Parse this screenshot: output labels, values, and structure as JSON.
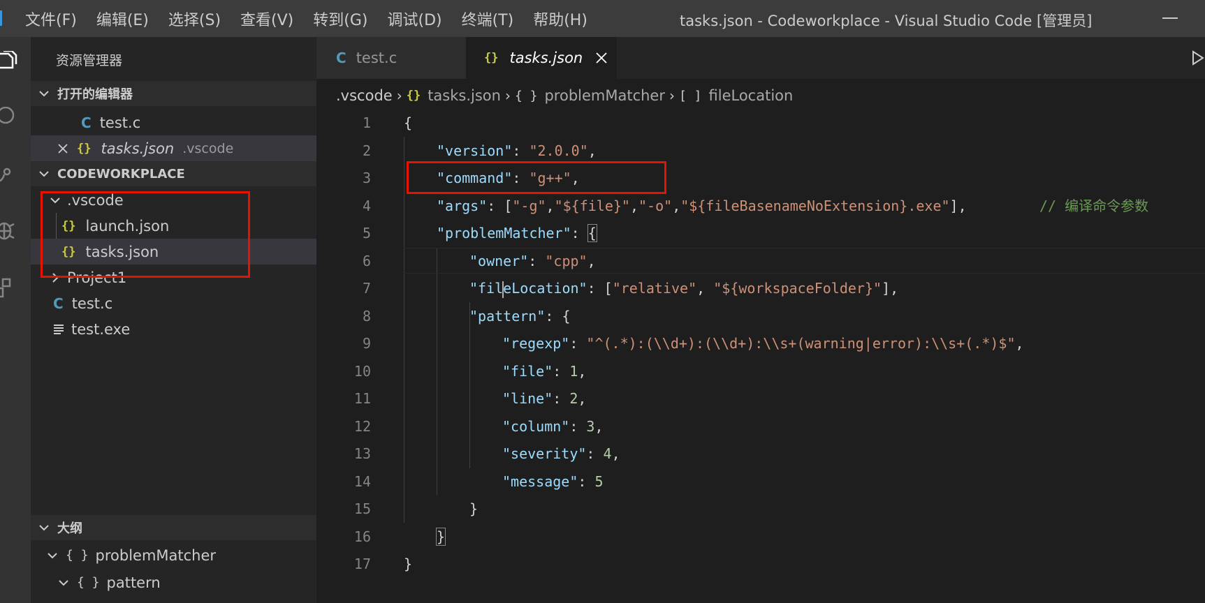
{
  "menu": [
    "文件(F)",
    "编辑(E)",
    "选择(S)",
    "查看(V)",
    "转到(G)",
    "调试(D)",
    "终端(T)",
    "帮助(H)"
  ],
  "window_title": "tasks.json - Codeworkplace - Visual Studio Code [管理员]",
  "sidebar": {
    "header": "资源管理器",
    "open_editors": {
      "title": "打开的编辑器",
      "items": [
        {
          "icon": "C",
          "label": "test.c"
        },
        {
          "icon": "{}",
          "label": "tasks.json",
          "folder": ".vscode"
        }
      ]
    },
    "workspace": {
      "title": "CODEWORKPLACE",
      "items": [
        {
          "label": ".vscode"
        },
        {
          "icon": "{}",
          "label": "launch.json"
        },
        {
          "icon": "{}",
          "label": "tasks.json"
        },
        {
          "label": "Project1"
        },
        {
          "icon": "C",
          "label": "test.c"
        },
        {
          "label": "test.exe"
        }
      ]
    },
    "outline": {
      "title": "大纲",
      "items": [
        {
          "icon": "{ }",
          "label": "problemMatcher"
        },
        {
          "icon": "{ }",
          "label": "pattern"
        }
      ]
    }
  },
  "tabs": [
    {
      "icon": "C",
      "label": "test.c",
      "active": false
    },
    {
      "icon": "{}",
      "label": "tasks.json",
      "active": true
    }
  ],
  "breadcrumb": {
    "folder": ".vscode",
    "file_icon": "{}",
    "file": "tasks.json",
    "obj_icon": "{ }",
    "obj": "problemMatcher",
    "arr_icon": "[ ]",
    "arr": "fileLocation"
  },
  "line_numbers": [
    "1",
    "2",
    "3",
    "4",
    "5",
    "6",
    "7",
    "8",
    "9",
    "10",
    "11",
    "12",
    "13",
    "14",
    "15",
    "16",
    "17"
  ],
  "code": {
    "l1": {
      "a": "{"
    },
    "l2": {
      "key": "\"version\"",
      "sep": ": ",
      "val": "\"2.0.0\"",
      "end": ","
    },
    "l3": {
      "key": "\"command\"",
      "sep": ": ",
      "val": "\"g++\"",
      "end": ","
    },
    "l4": {
      "key": "\"args\"",
      "sep": ": [",
      "v1": "\"-g\"",
      "c1": ",",
      "v2": "\"${file}\"",
      "c2": ",",
      "v3": "\"-o\"",
      "c3": ",",
      "v4": "\"${fileBasenameNoExtension}.exe\"",
      "end": "],",
      "comment": "// 编译命令参数"
    },
    "l5": {
      "key": "\"problemMatcher\"",
      "sep": ": ",
      "brace": "{"
    },
    "l6": {
      "key": "\"owner\"",
      "sep": ": ",
      "val": "\"cpp\"",
      "end": ","
    },
    "l7": {
      "key_a": "\"fil",
      "key_b": "eLocation\"",
      "sep": ": [",
      "v1": "\"relative\"",
      "c1": ", ",
      "v2": "\"${workspaceFolder}\"",
      "end": "],"
    },
    "l8": {
      "key": "\"pattern\"",
      "sep": ": {"
    },
    "l9": {
      "key": "\"regexp\"",
      "sep": ": ",
      "val": "\"^(.*):(\\\\d+):(\\\\d+):\\\\s+(warning|error):\\\\s+(.*)$\"",
      "end": ","
    },
    "l10": {
      "key": "\"file\"",
      "sep": ": ",
      "num": "1",
      "end": ","
    },
    "l11": {
      "key": "\"line\"",
      "sep": ": ",
      "num": "2",
      "end": ","
    },
    "l12": {
      "key": "\"column\"",
      "sep": ": ",
      "num": "3",
      "end": ","
    },
    "l13": {
      "key": "\"severity\"",
      "sep": ": ",
      "num": "4",
      "end": ","
    },
    "l14": {
      "key": "\"message\"",
      "sep": ": ",
      "num": "5"
    },
    "l15": {
      "a": "}"
    },
    "l16": {
      "a": "}"
    },
    "l17": {
      "a": "}"
    }
  },
  "colors": {
    "highlight_box": "#e51400",
    "json_icon": "#cbcb41",
    "c_icon": "#519aba",
    "key": "#9cdcfe",
    "string": "#ce9178",
    "number": "#b5cea8",
    "comment": "#6a9955"
  }
}
